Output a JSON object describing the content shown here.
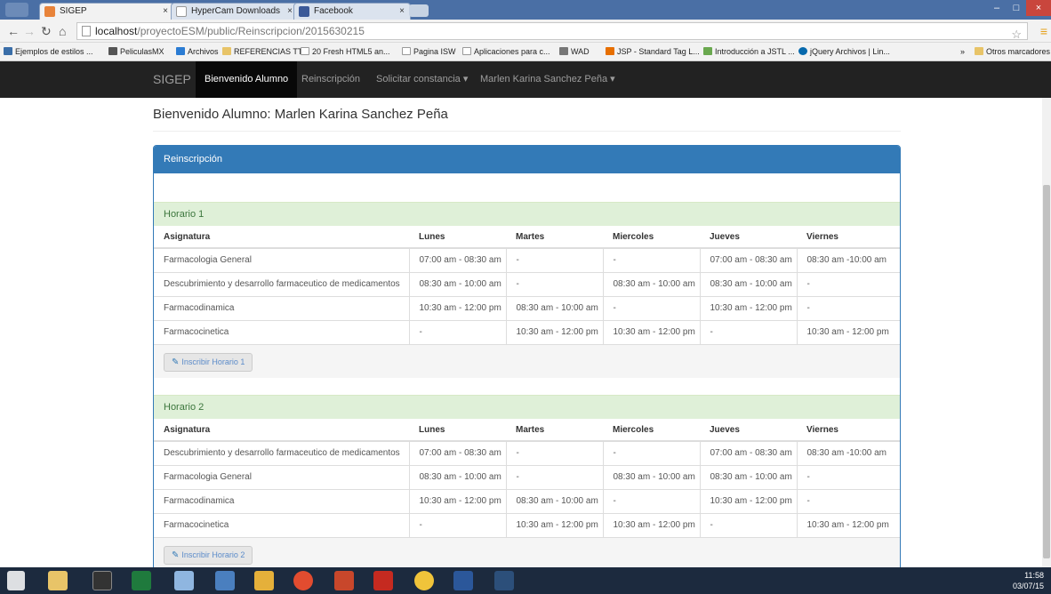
{
  "browser": {
    "tabs": [
      {
        "label": "SIGEP",
        "active": true
      },
      {
        "label": "HyperCam Downloads",
        "active": false
      },
      {
        "label": "Facebook",
        "active": false
      }
    ],
    "tab_close": "×",
    "url_host": "localhost",
    "url_path": "/proyectoESM/public/Reinscripcion/2015630215",
    "bookmarks": [
      "Ejemplos de estilos ...",
      "PeliculasMX",
      "Archivos",
      "REFERENCIAS TT",
      "20 Fresh HTML5 an...",
      "Pagina ISW",
      "Aplicaciones para c...",
      "WAD",
      "JSP - Standard Tag L...",
      "Introducción a JSTL ...",
      "jQuery Archivos | Lin..."
    ],
    "bookmarks_overflow": "»",
    "other_bookmarks": "Otros marcadores"
  },
  "navbar": {
    "brand": "SIGEP",
    "items": [
      {
        "label": "Bienvenido Alumno",
        "active": true
      },
      {
        "label": "Reinscripción",
        "active": false
      },
      {
        "label": "Solicitar constancia ▾",
        "active": false
      },
      {
        "label": "Marlen Karina Sanchez Peña ▾",
        "active": false
      }
    ]
  },
  "page": {
    "welcome": "Bienvenido Alumno: Marlen Karina Sanchez Peña",
    "panel_title": "Reinscripción"
  },
  "columns": [
    "Asignatura",
    "Lunes",
    "Martes",
    "Miercoles",
    "Jueves",
    "Viernes"
  ],
  "schedules": [
    {
      "title": "Horario 1",
      "button": "Inscribir Horario 1",
      "rows": [
        [
          "Farmacologia General",
          "07:00 am - 08:30 am",
          "-",
          "-",
          "07:00 am - 08:30 am",
          "08:30 am -10:00 am"
        ],
        [
          "Descubrimiento y desarrollo farmaceutico de medicamentos",
          "08:30 am - 10:00 am",
          "-",
          "08:30 am - 10:00 am",
          "08:30 am - 10:00 am",
          "-"
        ],
        [
          "Farmacodinamica",
          "10:30 am - 12:00 pm",
          "08:30 am - 10:00 am",
          "-",
          "10:30 am - 12:00 pm",
          "-"
        ],
        [
          "Farmacocinetica",
          "-",
          "10:30 am - 12:00 pm",
          "10:30 am - 12:00 pm",
          "-",
          "10:30 am - 12:00 pm"
        ]
      ]
    },
    {
      "title": "Horario 2",
      "button": "Inscribir Horario 2",
      "rows": [
        [
          "Descubrimiento y desarrollo farmaceutico de medicamentos",
          "07:00 am - 08:30 am",
          "-",
          "-",
          "07:00 am - 08:30 am",
          "08:30 am -10:00 am"
        ],
        [
          "Farmacologia General",
          "08:30 am - 10:00 am",
          "-",
          "08:30 am - 10:00 am",
          "08:30 am - 10:00 am",
          "-"
        ],
        [
          "Farmacodinamica",
          "10:30 am - 12:00 pm",
          "08:30 am - 10:00 am",
          "-",
          "10:30 am - 12:00 pm",
          "-"
        ],
        [
          "Farmacocinetica",
          "-",
          "10:30 am - 12:00 pm",
          "10:30 am - 12:00 pm",
          "-",
          "10:30 am - 12:00 pm"
        ]
      ]
    }
  ],
  "taskbar": {
    "time": "11:58",
    "date": "03/07/15"
  },
  "colors": {
    "navbar": "#222222",
    "panel_primary": "#337ab7",
    "schedule_heading": "#dff0d8",
    "taskbar": "#1c2a3e"
  }
}
